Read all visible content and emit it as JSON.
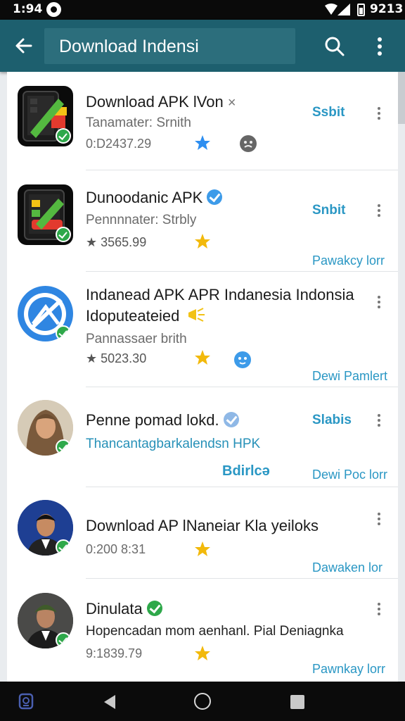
{
  "status_bar": {
    "time": "1:94",
    "battery_text": "9213",
    "icons": [
      "notification-circle-icon",
      "wifi-icon",
      "signal-icon",
      "battery-icon"
    ]
  },
  "app_bar": {
    "title": "Download Indensi",
    "icons": [
      "back-arrow-icon",
      "search-icon",
      "overflow-menu-icon"
    ]
  },
  "results": [
    {
      "name": "Download APK lVon",
      "name_suffix": "×",
      "subtitle": "Tanamater: Srnith",
      "meta": "0:D2437.29",
      "action": "Ssbit",
      "bottom_link": ""
    },
    {
      "name": "Dunoodanic APK",
      "subtitle": "Pennnnater: Strbly",
      "meta": "★ 3565.99",
      "action": "Snbit",
      "bottom_link": "Pawakcy lorr"
    },
    {
      "name": "Indanead APK APR Indanesia Indonsia",
      "name_line2": "Idoputeateied",
      "subtitle": "Pannassaer brith",
      "meta": "★ 5023.30",
      "action": "",
      "bottom_link": "Dewi Pamlert"
    },
    {
      "name": "Penne pomad lokd.",
      "subtitle": "Thancantagbarkalendsn HPK",
      "meta": "",
      "action": "Slabis",
      "middle_link": "Bdirlcə",
      "bottom_link": "Dewi Poc lorr"
    },
    {
      "name": "Download AP lNaneiar Kla yeiloks",
      "subtitle": "",
      "meta": "0:200 8:31",
      "action": "",
      "bottom_link": "Dawaken lor"
    },
    {
      "name": "Dinulata",
      "subtitle": "Hopencadan mom aenhanl. Pial Deniagnka",
      "meta": "9:1839.79",
      "action": "",
      "bottom_link": "Pawnkay lorr"
    }
  ],
  "colors": {
    "app_bar": "#1d5f6e",
    "accent_link": "#2a97c4",
    "verified_green": "#2ea84a",
    "verified_blue": "#3d9be9",
    "star_gold": "#f2b90b",
    "star_blue": "#2d8ef0"
  },
  "nav_bar": {
    "icons": [
      "assistant-icon",
      "nav-back-icon",
      "nav-home-icon",
      "nav-recents-icon"
    ]
  }
}
